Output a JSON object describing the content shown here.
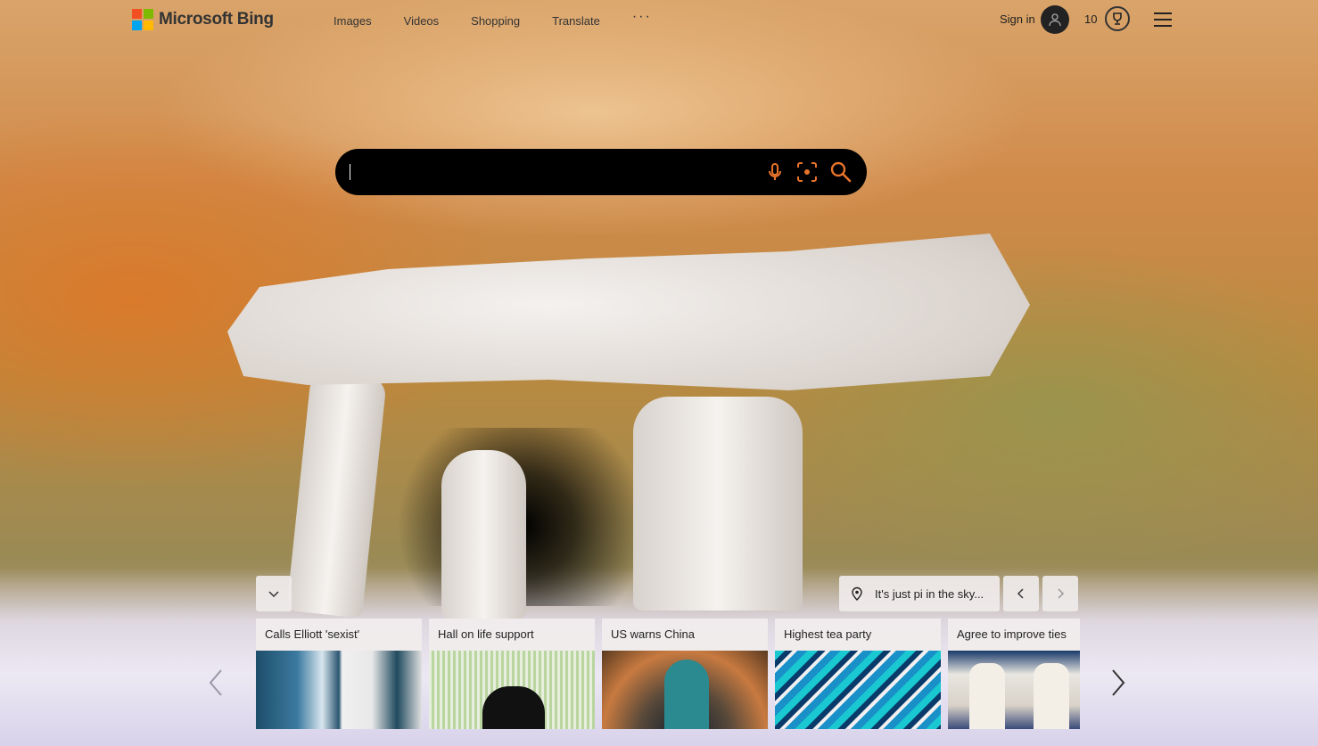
{
  "header": {
    "brand": "Microsoft Bing",
    "nav": [
      "Images",
      "Videos",
      "Shopping",
      "Translate"
    ],
    "more_label": "···",
    "sign_in": "Sign in",
    "points": "10"
  },
  "search": {
    "value": "",
    "placeholder": ""
  },
  "image_info": {
    "caption": "It's just pi in the sky..."
  },
  "news_cards": [
    {
      "title": "Calls Elliott 'sexist'"
    },
    {
      "title": "Hall on life support"
    },
    {
      "title": "US warns China"
    },
    {
      "title": "Highest tea party"
    },
    {
      "title": "Agree to improve ties"
    }
  ],
  "icons": {
    "logo": "microsoft-logo-icon",
    "avatar": "user-icon",
    "reward": "trophy-icon",
    "menu": "hamburger-icon",
    "mic": "microphone-icon",
    "visual_search": "camera-icon",
    "search": "search-icon",
    "collapse": "chevron-down-icon",
    "location": "location-pin-icon"
  },
  "colors": {
    "search_bg": "#000000",
    "search_icon_accent": "#e8742c"
  }
}
